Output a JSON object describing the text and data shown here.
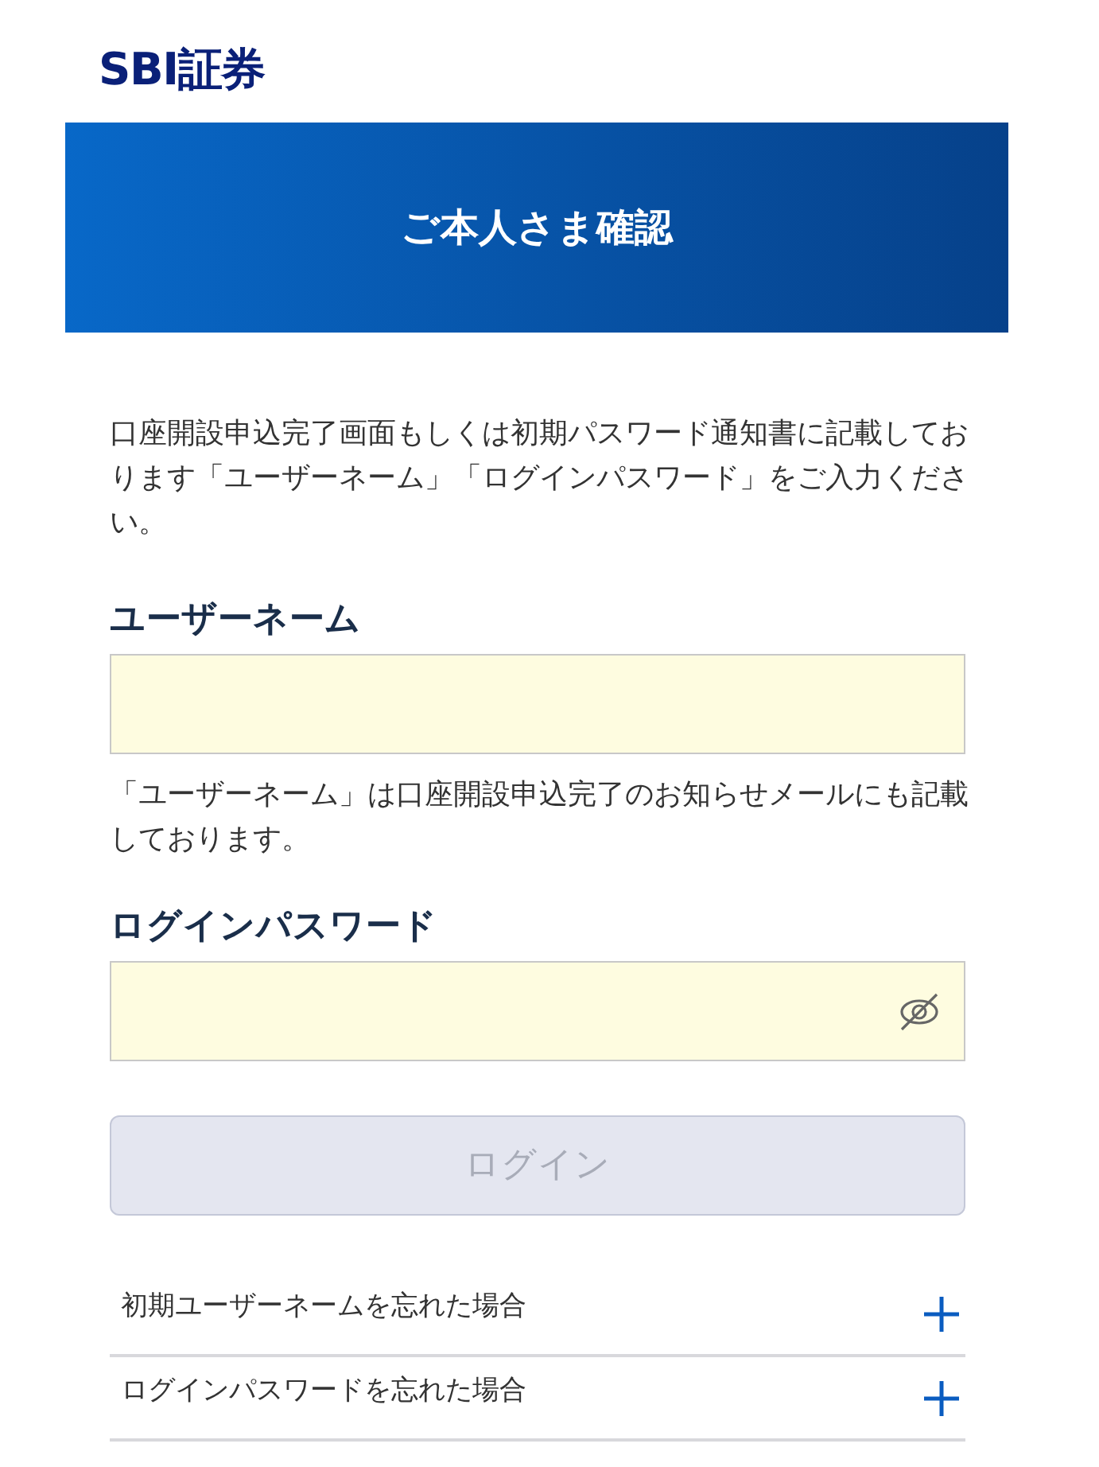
{
  "logo": {
    "text": "SBI証券"
  },
  "banner": {
    "title": "ご本人さま確認"
  },
  "intro": "口座開設申込完了画面もしくは初期パスワード通知書に記載しております「ユーザーネーム」「ログインパスワード」をご入力ください。",
  "fields": [
    {
      "kind": "text",
      "label": "ユーザーネーム",
      "note": "「ユーザーネーム」は口座開設申込完了のお知らせメールにも記載しております。"
    },
    {
      "kind": "password",
      "label": "ログインパスワード"
    }
  ],
  "login_button": {
    "label": "ログイン",
    "disabled": true
  },
  "help_items": [
    {
      "label": "初期ユーザーネームを忘れた場合",
      "expanded": false
    },
    {
      "label": "ログインパスワードを忘れた場合",
      "expanded": false
    }
  ]
}
